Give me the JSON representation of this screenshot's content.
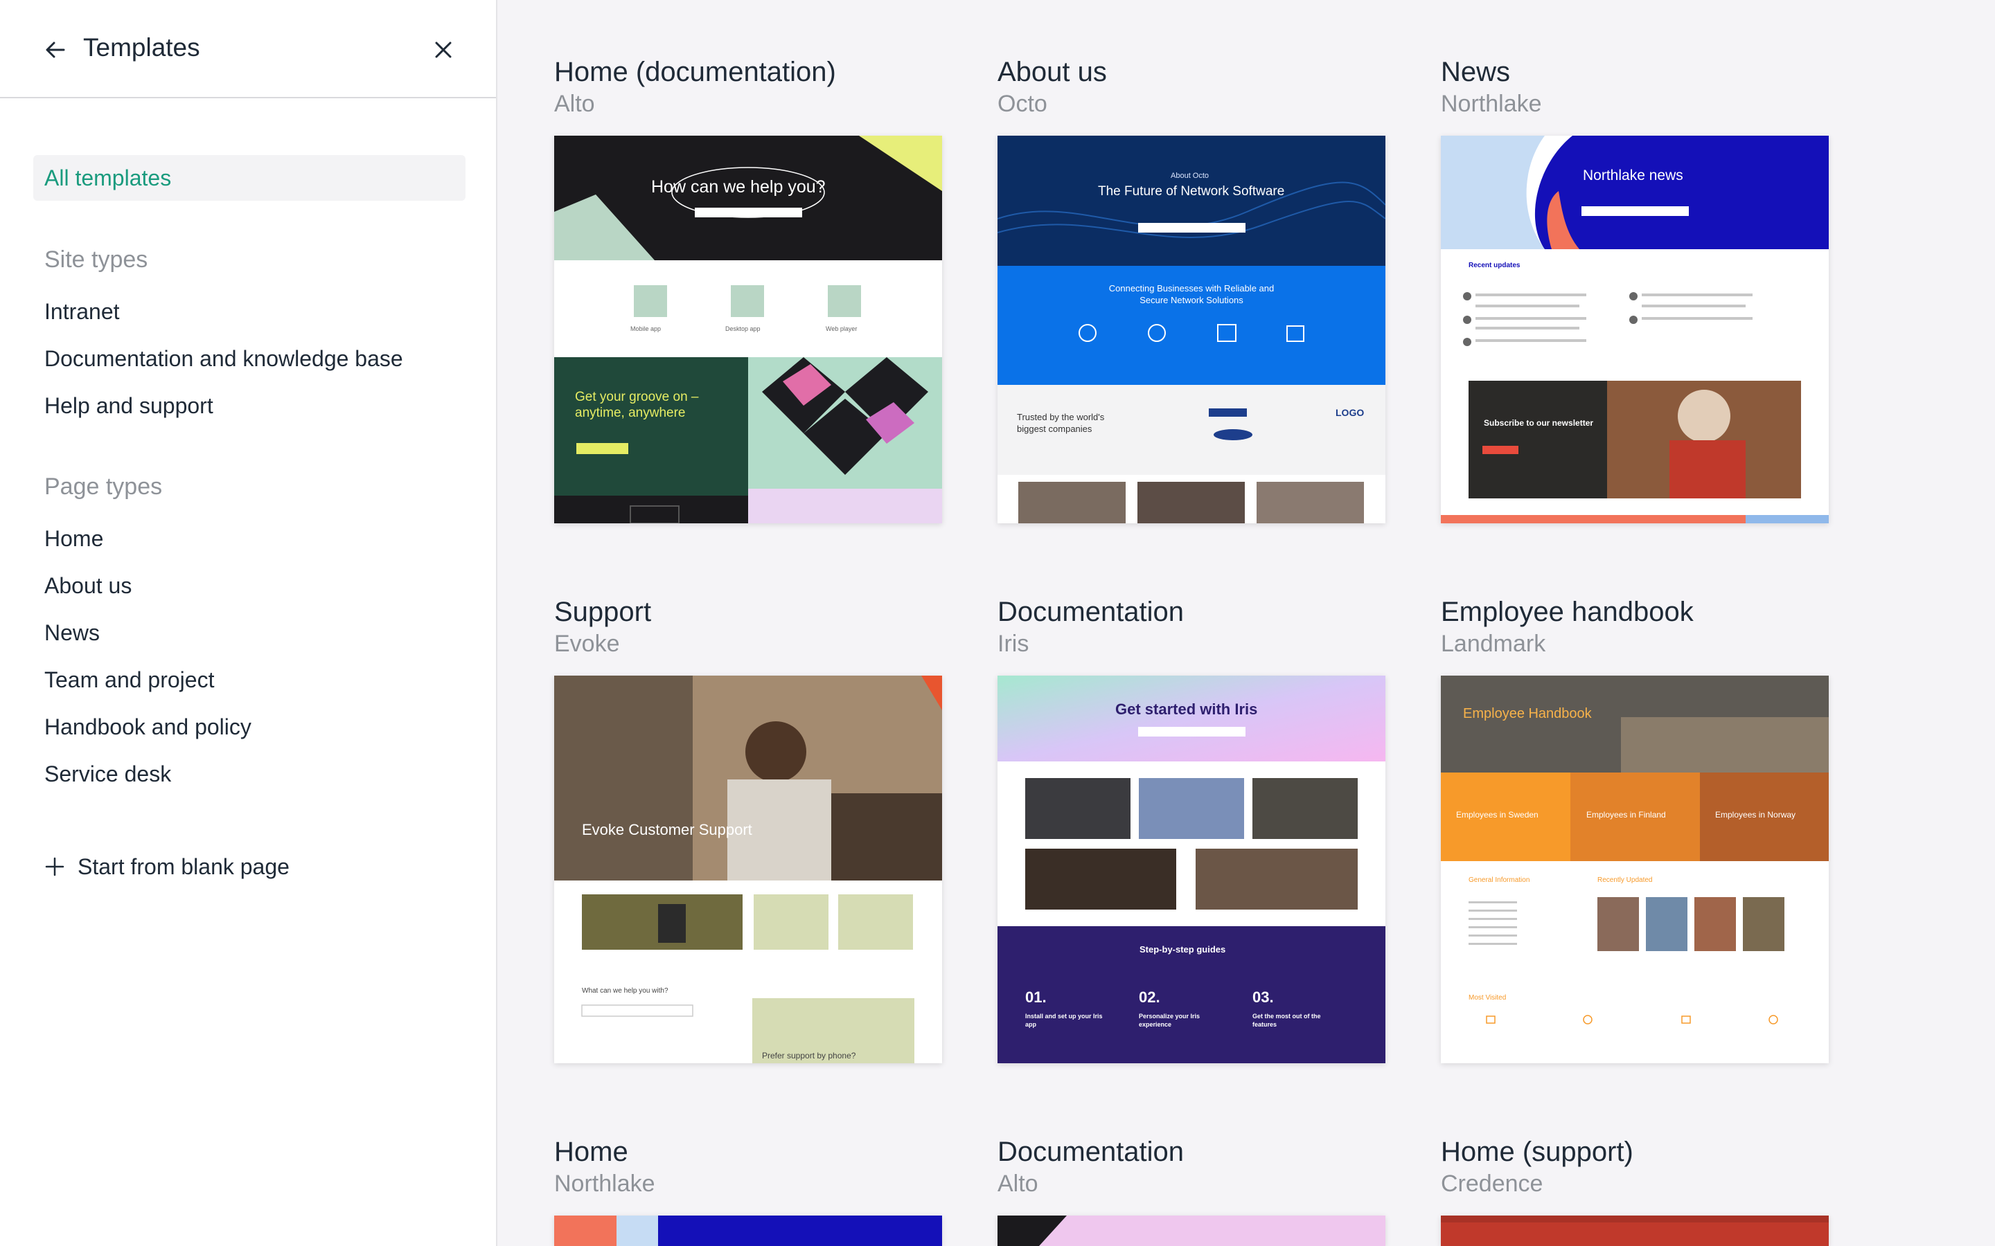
{
  "sidebar": {
    "title": "Templates",
    "all_templates": "All templates",
    "site_types_heading": "Site types",
    "site_types": [
      "Intranet",
      "Documentation and knowledge base",
      "Help and support"
    ],
    "page_types_heading": "Page types",
    "page_types": [
      "Home",
      "About us",
      "News",
      "Team and project",
      "Handbook and policy",
      "Service desk"
    ],
    "blank_page": "Start from blank page",
    "icons": {
      "back": "arrow-left-icon",
      "close": "close-icon",
      "add": "plus-icon"
    },
    "accent_color": "#1a9b7e"
  },
  "templates": [
    {
      "title": "Home (documentation)",
      "theme": "Alto",
      "preview": {
        "hero": "How can we help you?",
        "tiles": [
          "Mobile app",
          "Desktop app",
          "Web player"
        ],
        "promo": "Get your groove on – anytime, anywhere"
      }
    },
    {
      "title": "About us",
      "theme": "Octo",
      "preview": {
        "eyebrow": "About Octo",
        "hero": "The Future of Network Software",
        "band": "Connecting Businesses with Reliable and Secure Network Solutions",
        "trusted": "Trusted by the world's biggest companies",
        "logo": "LOGO"
      }
    },
    {
      "title": "News",
      "theme": "Northlake",
      "preview": {
        "hero": "Northlake news",
        "section": "Recent updates",
        "newsletter": "Subscribe to our newsletter"
      }
    },
    {
      "title": "Support",
      "theme": "Evoke",
      "preview": {
        "hero": "Evoke Customer Support",
        "question": "What can we help you with?",
        "phone": "Prefer support by phone?"
      }
    },
    {
      "title": "Documentation",
      "theme": "Iris",
      "preview": {
        "hero": "Get started with Iris",
        "guides": "Step-by-step guides",
        "steps": [
          "01.",
          "02.",
          "03."
        ],
        "step_labels": [
          "Install and set up your Iris app",
          "Personalize your Iris experience",
          "Get the most out of the features"
        ]
      }
    },
    {
      "title": "Employee handbook",
      "theme": "Landmark",
      "preview": {
        "hero": "Employee Handbook",
        "countries": [
          "Employees in Sweden",
          "Employees in Finland",
          "Employees in Norway"
        ],
        "sections": [
          "General Information",
          "Recently Updated",
          "Most Visited"
        ]
      }
    },
    {
      "title": "Home",
      "theme": "Northlake"
    },
    {
      "title": "Documentation",
      "theme": "Alto"
    },
    {
      "title": "Home (support)",
      "theme": "Credence"
    }
  ]
}
